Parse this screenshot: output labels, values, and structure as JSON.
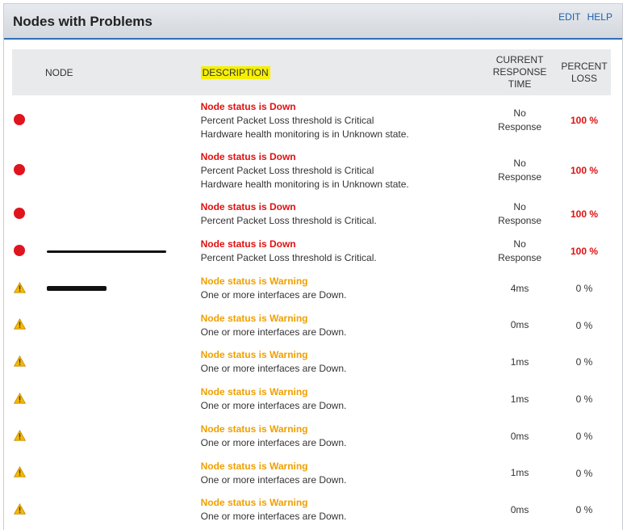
{
  "panel": {
    "title": "Nodes with Problems",
    "edit_label": "EDIT",
    "help_label": "HELP"
  },
  "table": {
    "headers": {
      "node": "NODE",
      "description": "DESCRIPTION",
      "response_line1": "CURRENT",
      "response_line2": "RESPONSE",
      "response_line3": "TIME",
      "loss_line1": "PERCENT",
      "loss_line2": "LOSS"
    },
    "rows": [
      {
        "status": "down",
        "icon": "red-dot-icon",
        "title": "Node status is Down",
        "line1": "Percent Packet Loss threshold is Critical",
        "line2": "Hardware health monitoring is in Unknown state.",
        "resp1": "No",
        "resp2": "Response",
        "loss": "100 %"
      },
      {
        "status": "down",
        "icon": "red-dot-icon",
        "title": "Node status is Down",
        "line1": "Percent Packet Loss threshold is Critical",
        "line2": "Hardware health monitoring is in Unknown state.",
        "resp1": "No",
        "resp2": "Response",
        "loss": "100 %"
      },
      {
        "status": "down",
        "icon": "red-dot-icon",
        "title": "Node status is Down",
        "line1": "Percent Packet Loss threshold is Critical.",
        "line2": "",
        "resp1": "No",
        "resp2": "Response",
        "loss": "100 %"
      },
      {
        "status": "down",
        "icon": "red-dot-icon",
        "title": "Node status is Down",
        "line1": "Percent Packet Loss threshold is Critical.",
        "line2": "",
        "resp1": "No",
        "resp2": "Response",
        "loss": "100 %"
      },
      {
        "status": "warning",
        "icon": "warning-icon",
        "title": "Node status is Warning",
        "line1": "One or more interfaces are Down.",
        "line2": "",
        "resp1": "4ms",
        "resp2": "",
        "loss": "0 %"
      },
      {
        "status": "warning",
        "icon": "warning-icon",
        "title": "Node status is Warning",
        "line1": "One or more interfaces are Down.",
        "line2": "",
        "resp1": "0ms",
        "resp2": "",
        "loss": "0 %"
      },
      {
        "status": "warning",
        "icon": "warning-icon",
        "title": "Node status is Warning",
        "line1": "One or more interfaces are Down.",
        "line2": "",
        "resp1": "1ms",
        "resp2": "",
        "loss": "0 %"
      },
      {
        "status": "warning",
        "icon": "warning-icon",
        "title": "Node status is Warning",
        "line1": "One or more interfaces are Down.",
        "line2": "",
        "resp1": "1ms",
        "resp2": "",
        "loss": "0 %"
      },
      {
        "status": "warning",
        "icon": "warning-icon",
        "title": "Node status is Warning",
        "line1": "One or more interfaces are Down.",
        "line2": "",
        "resp1": "0ms",
        "resp2": "",
        "loss": "0 %"
      },
      {
        "status": "warning",
        "icon": "warning-icon",
        "title": "Node status is Warning",
        "line1": "One or more interfaces are Down.",
        "line2": "",
        "resp1": "1ms",
        "resp2": "",
        "loss": "0 %"
      },
      {
        "status": "warning",
        "icon": "warning-icon",
        "title": "Node status is Warning",
        "line1": "One or more interfaces are Down.",
        "line2": "",
        "resp1": "0ms",
        "resp2": "",
        "loss": "0 %"
      }
    ]
  },
  "colors": {
    "down": "#e01010",
    "warning": "#f0a000",
    "header_accent": "#2f6fb8",
    "highlight": "#f6f000"
  }
}
